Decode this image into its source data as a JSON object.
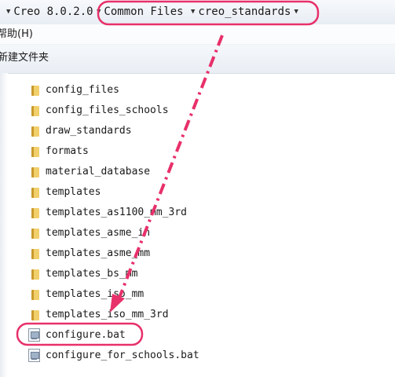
{
  "breadcrumb": {
    "items": [
      "Creo 8.0.2.0",
      "Common Files",
      "creo_standards"
    ]
  },
  "menubar": {
    "help": "帮助(H)"
  },
  "toolbar": {
    "new_folder": "新建文件夹"
  },
  "files": {
    "folders": [
      "config_files",
      "config_files_schools",
      "draw_standards",
      "formats",
      "material_database",
      "templates",
      "templates_as1100_mm_3rd",
      "templates_asme_in",
      "templates_asme_mm",
      "templates_bs_mm",
      "templates_iso_mm",
      "templates_iso_mm_3rd"
    ],
    "bat_files": [
      "configure.bat",
      "configure_for_schools.bat"
    ]
  },
  "colors": {
    "annotation": "#e8306a",
    "folder": "#f1cf6b"
  },
  "icons": {
    "folder": "folder-icon",
    "bat": "batch-file-icon",
    "crumb_arrow": "chevron-down-icon"
  }
}
